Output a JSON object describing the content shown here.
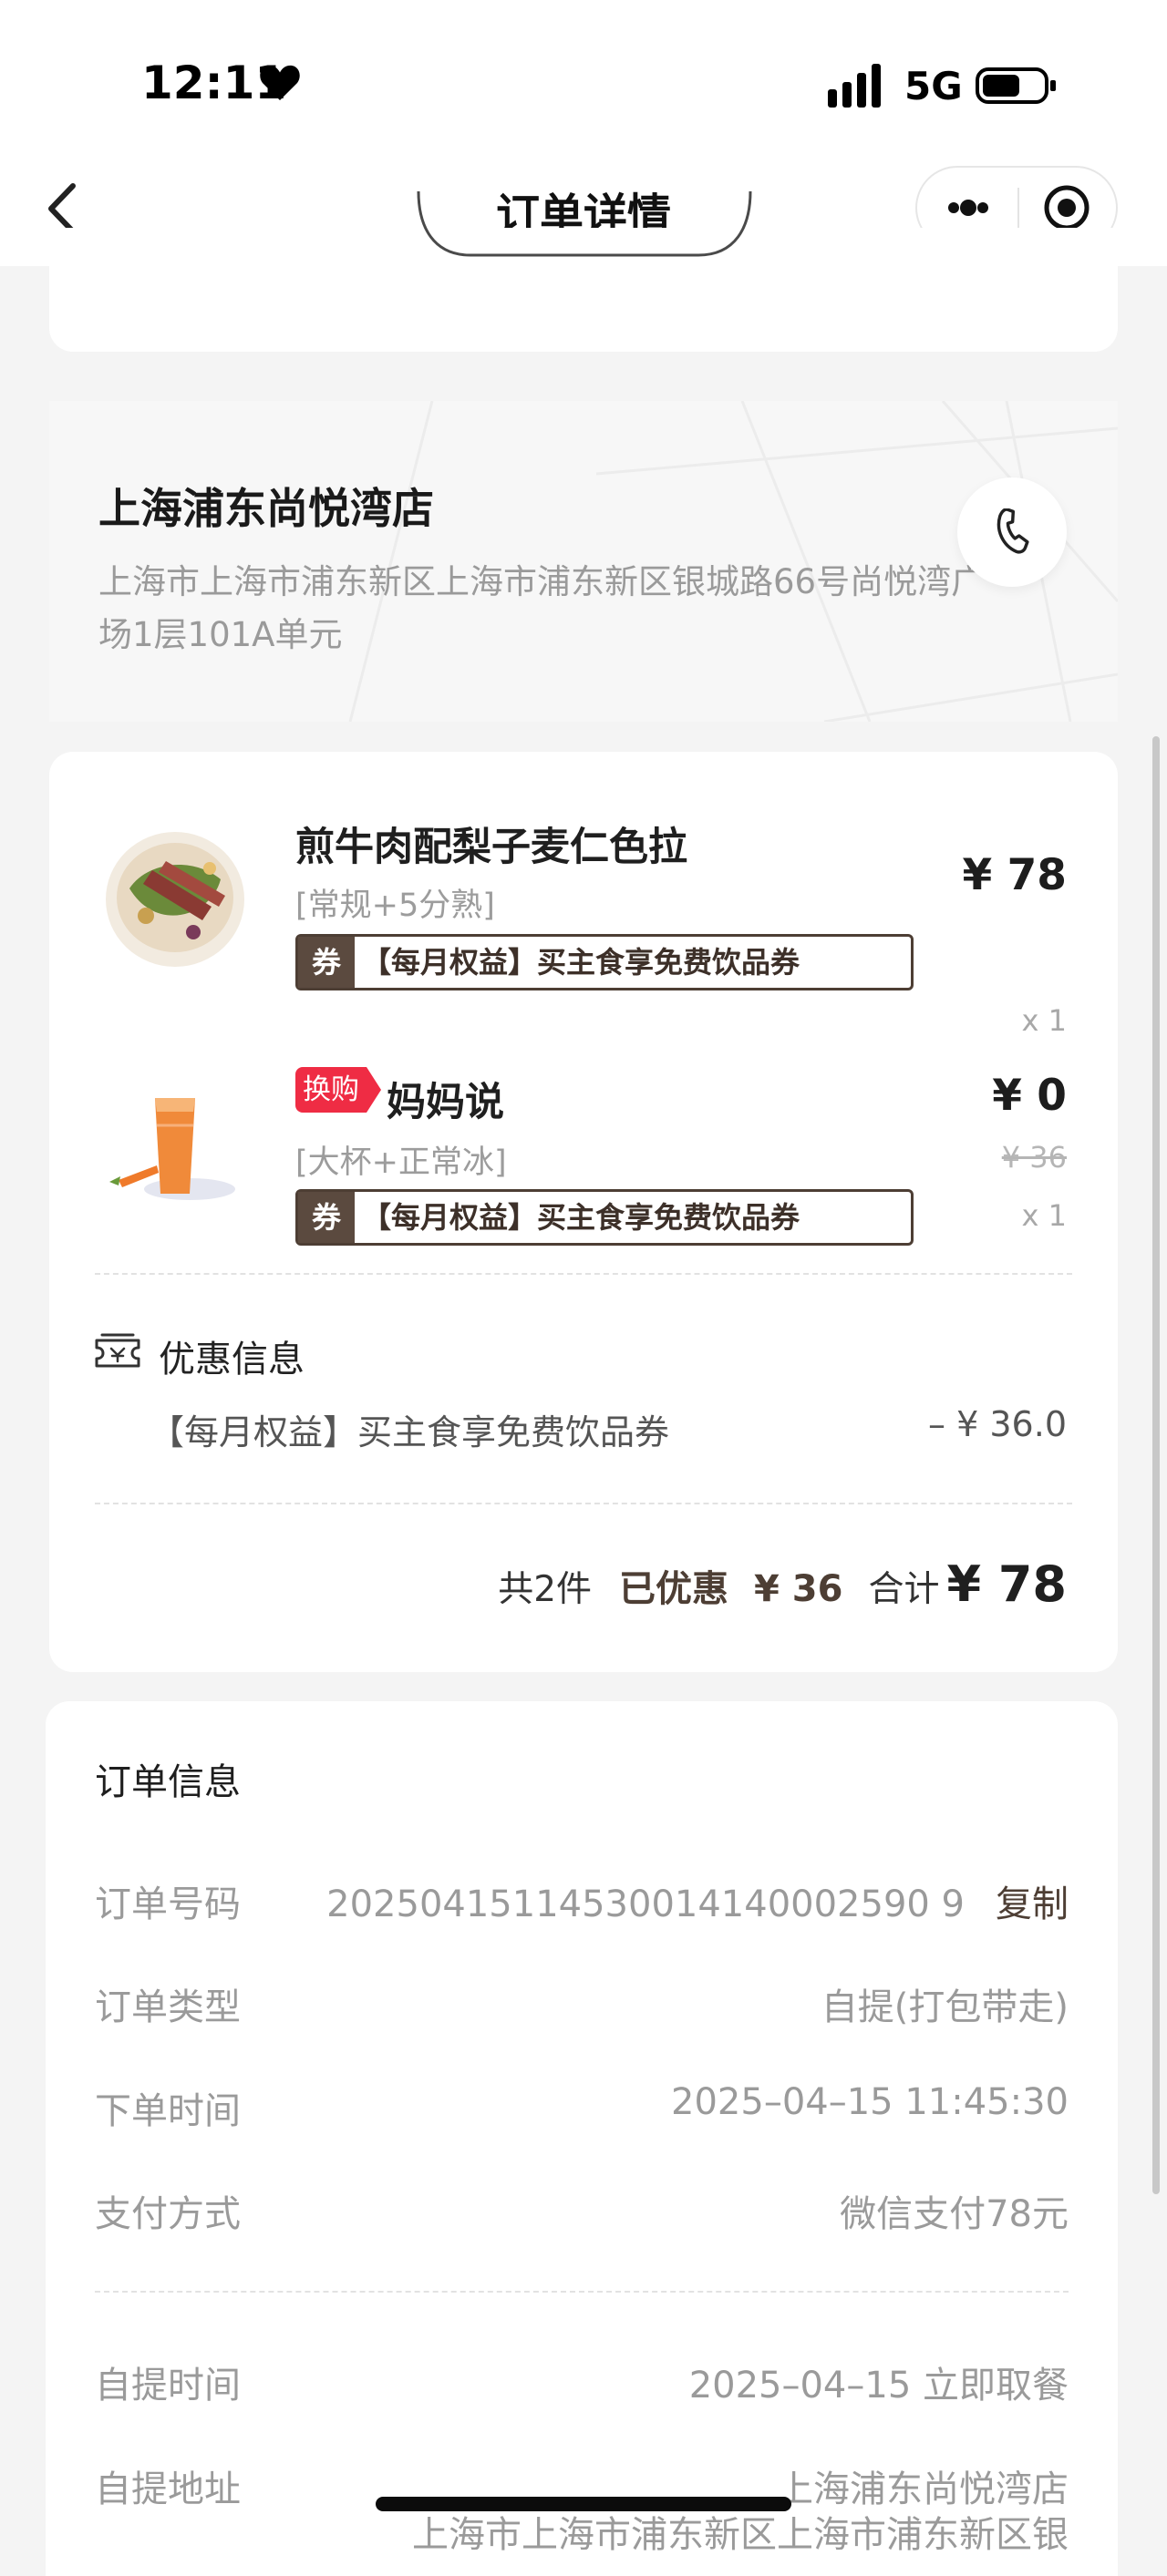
{
  "status_bar": {
    "time": "12:11",
    "network": "5G"
  },
  "nav": {
    "title": "订单详情"
  },
  "store": {
    "name": "上海浦东尚悦湾店",
    "address": "上海市上海市浦东新区上海市浦东新区银城路66号尚悦湾广场1层101A单元"
  },
  "items": [
    {
      "name": "煎牛肉配梨子麦仁色拉",
      "spec": "[常规+5分熟]",
      "coupon_tag": "券",
      "coupon_text": "【每月权益】买主食享免费饮品券",
      "price": "¥ 78",
      "qty": "x 1"
    },
    {
      "badge": "换购",
      "name": "妈妈说",
      "spec": "[大杯+正常冰]",
      "coupon_tag": "券",
      "coupon_text": "【每月权益】买主食享免费饮品券",
      "price": "¥ 0",
      "original_price": "¥ 36",
      "qty": "x 1"
    }
  ],
  "discount": {
    "title": "优惠信息",
    "name": "【每月权益】买主食享免费饮品券",
    "amount": "– ¥ 36.0"
  },
  "summary": {
    "count": "共2件",
    "discount_label": "已优惠",
    "discount_value": "¥ 36",
    "total_label": "合计",
    "total_value": "¥ 78"
  },
  "order_info": {
    "title": "订单信息",
    "rows": [
      {
        "label": "订单号码",
        "value": "20250415114530014140002590 9",
        "action": "复制"
      },
      {
        "label": "订单类型",
        "value": "自提(打包带走)"
      },
      {
        "label": "下单时间",
        "value": "2025–04–15 11:45:30"
      },
      {
        "label": "支付方式",
        "value": "微信支付78元"
      },
      {
        "label": "自提时间",
        "value": "2025–04–15 立即取餐"
      },
      {
        "label": "自提地址",
        "value": "上海浦东尚悦湾店"
      }
    ],
    "address_continued": "上海市上海市浦东新区上海市浦东新区银"
  },
  "colors": {
    "accent": "#4d3e34",
    "badge_red": "#ef2c44",
    "muted": "#9a9a9a"
  }
}
